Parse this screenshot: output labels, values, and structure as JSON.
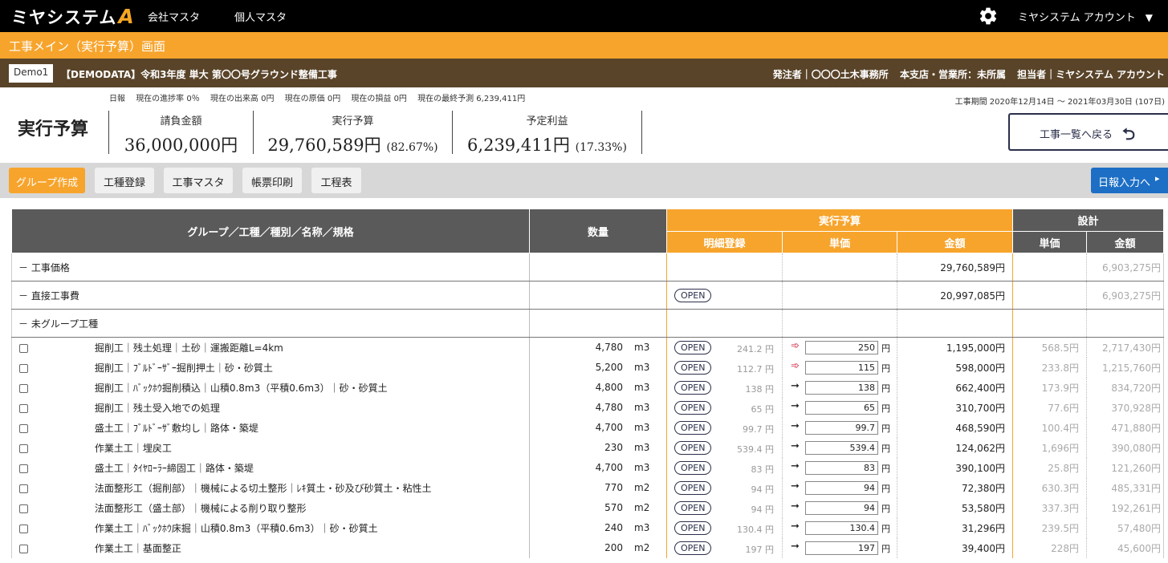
{
  "topbar": {
    "logo_text": "ミヤシステム",
    "logo_mark": "A",
    "nav": [
      "会社マスタ",
      "個人マスタ"
    ],
    "account_label": "ミヤシステム アカウント"
  },
  "page_title": "工事メイン（実行予算）画面",
  "project": {
    "tag": "Demo1",
    "title": "【DEMODATA】令和3年度 単大 第〇〇号グラウンド整備工事",
    "client": "発注者｜〇〇〇土木事務所",
    "branch": "本支店・営業所：未所属",
    "manager": "担当者｜ミヤシステム アカウント"
  },
  "status": [
    "日報",
    "現在の進捗率 0％",
    "現在の出来高 0円",
    "現在の原価 0円",
    "現在の損益 0円",
    "現在の最終予測 6,239,411円"
  ],
  "period": "工事期間 2020年12月14日 〜 2021年03月30日 (107日)",
  "summary": {
    "title": "実行予算",
    "contract": {
      "label": "請負金額",
      "value": "36,000,000円"
    },
    "budget": {
      "label": "実行予算",
      "value": "29,760,589円",
      "pct": "(82.67%)"
    },
    "profit": {
      "label": "予定利益",
      "value": "6,239,411円",
      "pct": "(17.33%)"
    }
  },
  "back_button": "工事一覧へ戻る",
  "toolbar": {
    "buttons": [
      "グループ作成",
      "工種登録",
      "工事マスタ",
      "帳票印刷",
      "工程表"
    ],
    "nippou": "日報入力へ"
  },
  "table": {
    "headers": {
      "name": "グループ／工種／種別／名称／規格",
      "qty": "数量",
      "budget": "実行予算",
      "detail": "明細登録",
      "unit_price": "単価",
      "amount": "金額",
      "design": "設計",
      "d_unit": "単価",
      "d_amount": "金額"
    },
    "open_label": "OPEN",
    "groups": [
      {
        "label": "－ 工事価格",
        "amount": "29,760,589円",
        "d_amount": "6,903,275円",
        "open": false
      },
      {
        "label": "－ 直接工事費",
        "amount": "20,997,085円",
        "d_amount": "6,903,275円",
        "open": true
      },
      {
        "label": "－ 未グループ工種",
        "amount": "",
        "d_amount": "",
        "open": false
      }
    ],
    "rows": [
      {
        "name": "掘削工｜残土処理｜土砂｜運搬距離L=4km",
        "qty": "4,780",
        "unit": "m3",
        "est": "241.2 円",
        "arrow": "red",
        "price": "250",
        "amount": "1,195,000円",
        "d_unit": "568.5円",
        "d_amount": "2,717,430円"
      },
      {
        "name": "掘削工｜ﾌﾞﾙﾄﾞｰｻﾞｰ掘削押土｜砂・砂質土",
        "qty": "5,200",
        "unit": "m3",
        "est": "112.7 円",
        "arrow": "red",
        "price": "115",
        "amount": "598,000円",
        "d_unit": "233.8円",
        "d_amount": "1,215,760円"
      },
      {
        "name": "掘削工｜ﾊﾞｯｸﾎｳ掘削積込｜山積0.8m3（平積0.6m3）｜砂・砂質土",
        "qty": "4,800",
        "unit": "m3",
        "est": "138 円",
        "arrow": "black",
        "price": "138",
        "amount": "662,400円",
        "d_unit": "173.9円",
        "d_amount": "834,720円"
      },
      {
        "name": "掘削工｜残土受入地での処理",
        "qty": "4,780",
        "unit": "m3",
        "est": "65 円",
        "arrow": "black",
        "price": "65",
        "amount": "310,700円",
        "d_unit": "77.6円",
        "d_amount": "370,928円"
      },
      {
        "name": "盛土工｜ﾌﾞﾙﾄﾞｰｻﾞ敷均し｜路体・築堤",
        "qty": "4,700",
        "unit": "m3",
        "est": "99.7 円",
        "arrow": "black",
        "price": "99.7",
        "amount": "468,590円",
        "d_unit": "100.4円",
        "d_amount": "471,880円"
      },
      {
        "name": "作業土工｜埋戻工",
        "qty": "230",
        "unit": "m3",
        "est": "539.4 円",
        "arrow": "black",
        "price": "539.4",
        "amount": "124,062円",
        "d_unit": "1,696円",
        "d_amount": "390,080円"
      },
      {
        "name": "盛土工｜ﾀｲﾔﾛｰﾗｰ締固工｜路体・築堤",
        "qty": "4,700",
        "unit": "m3",
        "est": "83 円",
        "arrow": "black",
        "price": "83",
        "amount": "390,100円",
        "d_unit": "25.8円",
        "d_amount": "121,260円"
      },
      {
        "name": "法面整形工（掘削部）｜機械による切土整形｜ﾚｷ質土・砂及び砂質土・粘性土",
        "qty": "770",
        "unit": "m2",
        "est": "94 円",
        "arrow": "black",
        "price": "94",
        "amount": "72,380円",
        "d_unit": "630.3円",
        "d_amount": "485,331円"
      },
      {
        "name": "法面整形工（盛土部）｜機械による削り取り整形",
        "qty": "570",
        "unit": "m2",
        "est": "94 円",
        "arrow": "black",
        "price": "94",
        "amount": "53,580円",
        "d_unit": "337.3円",
        "d_amount": "192,261円"
      },
      {
        "name": "作業土工｜ﾊﾞｯｸﾎｳ床掘｜山積0.8m3（平積0.6m3）｜砂・砂質土",
        "qty": "240",
        "unit": "m3",
        "est": "130.4 円",
        "arrow": "black",
        "price": "130.4",
        "amount": "31,296円",
        "d_unit": "239.5円",
        "d_amount": "57,480円"
      },
      {
        "name": "作業土工｜基面整正",
        "qty": "200",
        "unit": "m2",
        "est": "197 円",
        "arrow": "black",
        "price": "197",
        "amount": "39,400円",
        "d_unit": "228円",
        "d_amount": "45,600円"
      }
    ]
  },
  "colors": {
    "orange": "#f7a42c",
    "brown": "#594429",
    "blue": "#1d6fc5",
    "navy": "#2b2f4a"
  },
  "icons": {
    "settings": "gear-icon",
    "back": "return-arrow-icon",
    "dropdown": "caret-down-icon",
    "next": "chevron-right-icon"
  }
}
